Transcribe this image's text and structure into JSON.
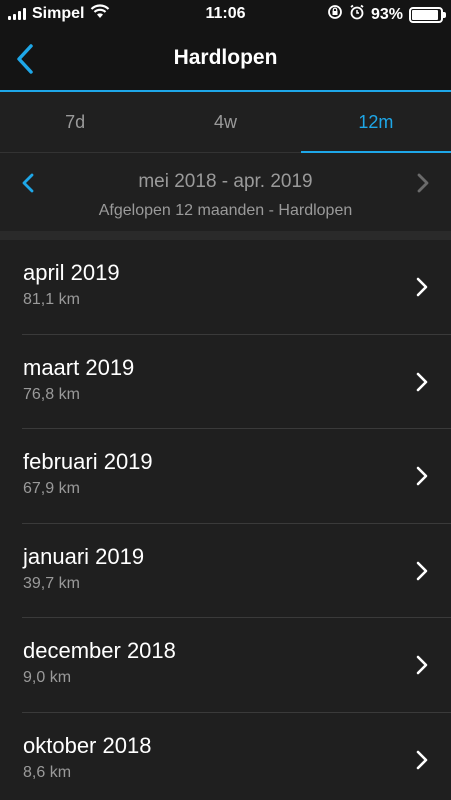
{
  "status_bar": {
    "carrier": "Simpel",
    "time": "11:06",
    "battery_percent": "93%",
    "battery_level": 0.93,
    "icons": [
      "signal-icon",
      "wifi-icon",
      "rotation-lock-icon",
      "alarm-icon",
      "battery-icon"
    ]
  },
  "nav": {
    "title": "Hardlopen",
    "back_icon": "chevron-left-icon",
    "accent_color": "#1ea7e8"
  },
  "tabs": [
    {
      "label": "7d",
      "active": false
    },
    {
      "label": "4w",
      "active": false
    },
    {
      "label": "12m",
      "active": true
    }
  ],
  "period": {
    "range": "mei 2018 - apr. 2019",
    "subtitle": "Afgelopen 12 maanden - Hardlopen"
  },
  "months": [
    {
      "title": "april 2019",
      "value": "81,1 km"
    },
    {
      "title": "maart 2019",
      "value": "76,8 km"
    },
    {
      "title": "februari 2019",
      "value": "67,9 km"
    },
    {
      "title": "januari 2019",
      "value": "39,7 km"
    },
    {
      "title": "december 2018",
      "value": "9,0 km"
    },
    {
      "title": "oktober 2018",
      "value": "8,6 km"
    }
  ]
}
